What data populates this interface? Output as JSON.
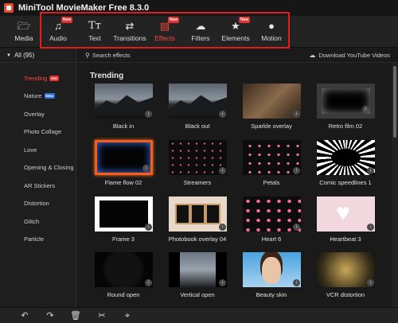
{
  "app": {
    "title": "MiniTool MovieMaker Free 8.3.0"
  },
  "toolbar": {
    "items": [
      {
        "label": "Media",
        "icon": "folder-icon"
      },
      {
        "label": "Audio",
        "icon": "music-note-icon",
        "badge": "New"
      },
      {
        "label": "Text",
        "icon": "text-icon"
      },
      {
        "label": "Transitions",
        "icon": "transitions-icon"
      },
      {
        "label": "Effects",
        "icon": "effects-icon",
        "badge": "New",
        "active": true
      },
      {
        "label": "Filters",
        "icon": "filters-icon"
      },
      {
        "label": "Elements",
        "icon": "elements-icon",
        "badge": "New"
      },
      {
        "label": "Motion",
        "icon": "motion-icon"
      }
    ],
    "highlight_color": "#e11d1d"
  },
  "sidebar": {
    "header": "All (95)",
    "items": [
      {
        "label": "Trending",
        "tag": "Hot",
        "active": true
      },
      {
        "label": "Nature",
        "tag": "New"
      },
      {
        "label": "Overlay"
      },
      {
        "label": "Photo Collage"
      },
      {
        "label": "Love"
      },
      {
        "label": "Opening & Closing"
      },
      {
        "label": "AR Stickers"
      },
      {
        "label": "Distortion"
      },
      {
        "label": "Glitch"
      },
      {
        "label": "Particle"
      }
    ]
  },
  "search": {
    "label": "Search effects"
  },
  "download_link": "Download YouTube Videos",
  "section": {
    "title": "Trending"
  },
  "effects": [
    "Black in",
    "Black out",
    "Sparkle overlay",
    "Retro film 02",
    "Flame flow 02",
    "Streamers",
    "Petals",
    "Comic speedlines 1",
    "Frame 3",
    "Photobook overlay 04",
    "Heart 6",
    "Heartbeat 3",
    "Round open",
    "Vertical open",
    "Beauty skin",
    "VCR distortion"
  ],
  "colors": {
    "accent": "#ff4a3d",
    "background": "#1a1a1a"
  }
}
